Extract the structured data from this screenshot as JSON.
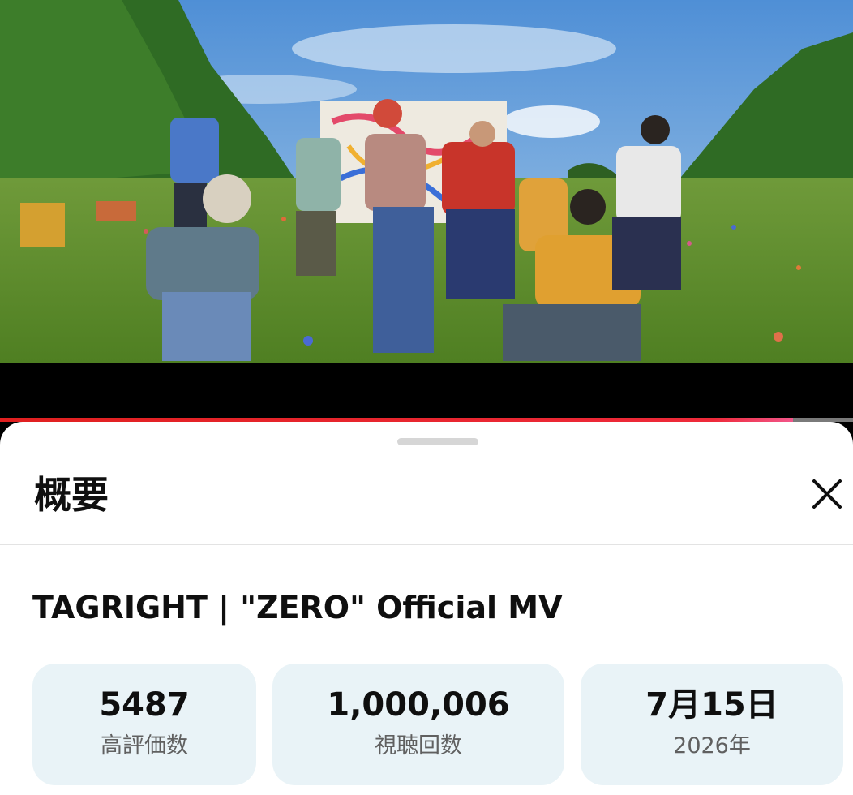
{
  "player": {
    "progress_fraction": 0.93
  },
  "panel": {
    "title": "概要",
    "close_icon": "close-icon",
    "video_title": "TAGRIGHT | \"ZERO\" Official MV"
  },
  "stats": [
    {
      "value": "5487",
      "label": "高評価数"
    },
    {
      "value": "1,000,006",
      "label": "視聴回数"
    },
    {
      "value": "7月15日",
      "label": "2026年"
    }
  ],
  "colors": {
    "progress": "#e02020",
    "stat_background": "#e9f3f7"
  }
}
